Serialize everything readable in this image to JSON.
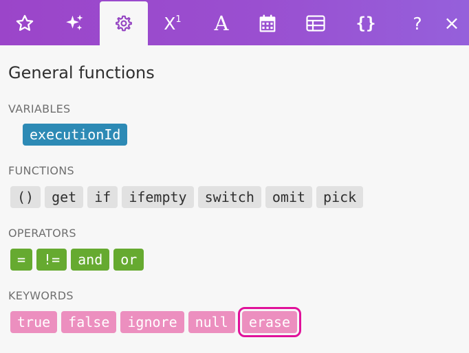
{
  "tabs": [
    {
      "icon": "star-icon",
      "glyph": ""
    },
    {
      "icon": "sparkles-icon",
      "glyph": ""
    },
    {
      "icon": "gear-icon",
      "glyph": "",
      "active": true
    },
    {
      "icon": "superscript-icon",
      "glyph": "X"
    },
    {
      "icon": "text-icon",
      "glyph": "A"
    },
    {
      "icon": "calendar-icon",
      "glyph": ""
    },
    {
      "icon": "table-icon",
      "glyph": ""
    },
    {
      "icon": "braces-icon",
      "glyph": "{}"
    },
    {
      "icon": "help-icon",
      "glyph": "?"
    },
    {
      "icon": "close-icon",
      "glyph": "×"
    }
  ],
  "superscript": "1",
  "panel": {
    "title": "General functions",
    "sections": {
      "variables": {
        "label": "VARIABLES",
        "items": [
          "executionId"
        ]
      },
      "functions": {
        "label": "FUNCTIONS",
        "items": [
          "()",
          "get",
          "if",
          "ifempty",
          "switch",
          "omit",
          "pick"
        ]
      },
      "operators": {
        "label": "OPERATORS",
        "items": [
          "=",
          "!=",
          "and",
          "or"
        ]
      },
      "keywords": {
        "label": "KEYWORDS",
        "items": [
          "true",
          "false",
          "ignore",
          "null",
          "erase"
        ],
        "selected": "erase"
      }
    }
  },
  "colors": {
    "header_gradient_start": "#9b45c9",
    "header_gradient_end": "#9560db",
    "variable_chip": "#2d8ab5",
    "function_chip": "#e1e1e1",
    "operator_chip": "#66aa30",
    "keyword_chip": "#ec8fbf",
    "selection_outline": "#e0119a"
  }
}
